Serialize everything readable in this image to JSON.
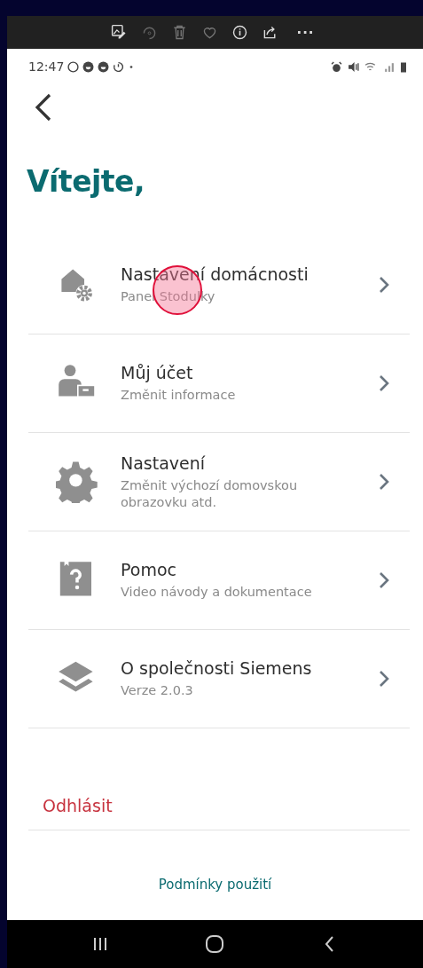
{
  "viewer_toolbar": {
    "more": "···"
  },
  "status_bar": {
    "time": "12:47"
  },
  "title": "Vítejte,",
  "menu": [
    {
      "title": "Nastavení domácnosti",
      "subtitle": "Panel Stodulky"
    },
    {
      "title": "Můj účet",
      "subtitle": "Změnit informace"
    },
    {
      "title": "Nastavení",
      "subtitle": "Změnit výchozí domovskou obrazovku atd."
    },
    {
      "title": "Pomoc",
      "subtitle": "Video návody a dokumentace"
    },
    {
      "title": "O společnosti Siemens",
      "subtitle": "Verze 2.0.3"
    }
  ],
  "logout": "Odhlásit",
  "footer_link": "Podmínky použití",
  "touch_indicator": true
}
